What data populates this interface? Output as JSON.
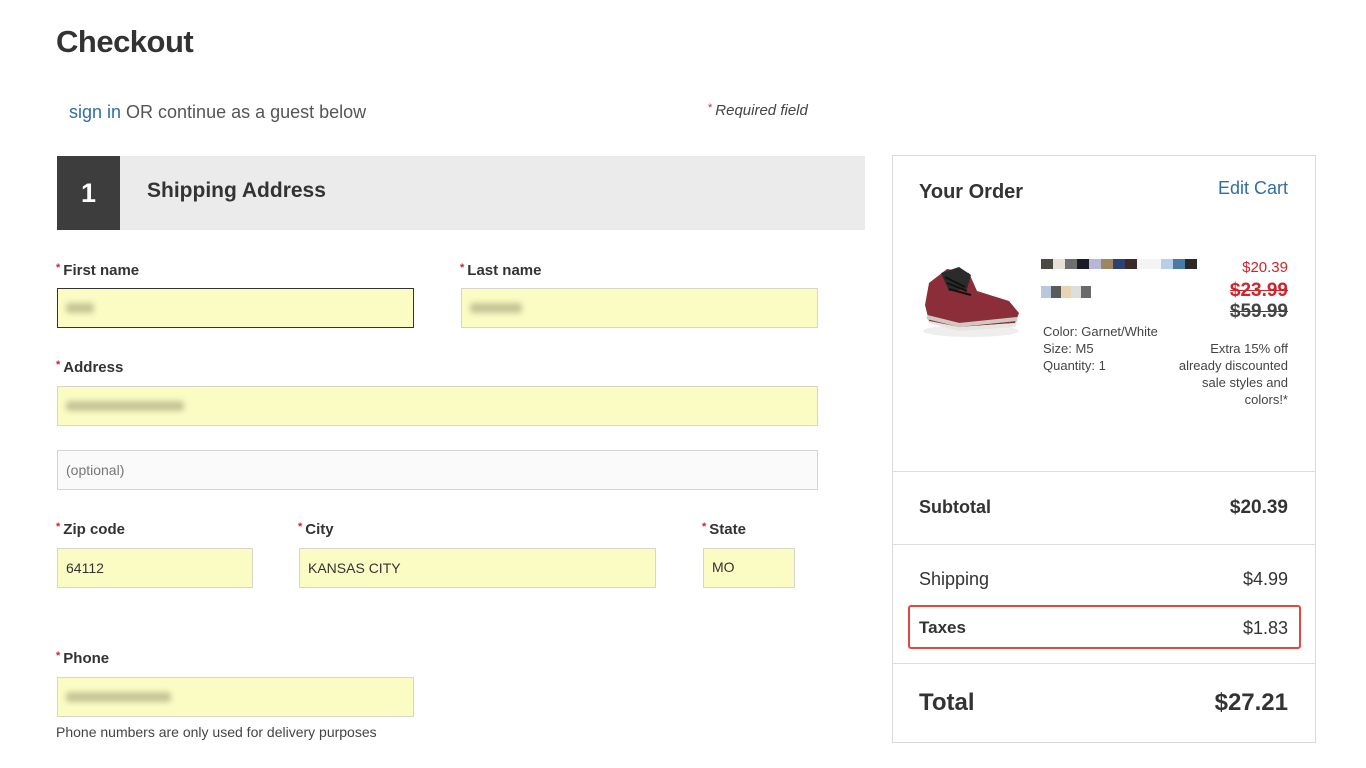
{
  "page": {
    "title": "Checkout",
    "signin_link": "sign in",
    "signin_rest": " OR continue as a guest below",
    "required_marker": "*",
    "required_note": "Required field"
  },
  "step": {
    "number": "1",
    "title": "Shipping Address"
  },
  "form": {
    "first_name": {
      "label": "First name",
      "value_redacted": true
    },
    "last_name": {
      "label": "Last name",
      "value_redacted": true
    },
    "address": {
      "label": "Address",
      "value_redacted": true
    },
    "address2": {
      "placeholder": "(optional)"
    },
    "zip": {
      "label": "Zip code",
      "value": "64112"
    },
    "city": {
      "label": "City",
      "value": "KANSAS CITY"
    },
    "state": {
      "label": "State",
      "value": "MO"
    },
    "phone": {
      "label": "Phone",
      "value_redacted": true
    },
    "phone_hint": "Phone numbers are only used for delivery purposes"
  },
  "order": {
    "title": "Your Order",
    "edit_cart": "Edit Cart",
    "item": {
      "image_icon": "shoe-image",
      "name_redacted": true,
      "color": "Color:  Garnet/White",
      "size": "Size:  M5",
      "quantity": "Quantity: 1",
      "price_now": "$20.39",
      "price_was": "$23.99",
      "price_original": "$59.99",
      "promo": "Extra 15% off already discounted sale styles and colors!*"
    },
    "subtotal": {
      "label": "Subtotal",
      "value": "$20.39"
    },
    "shipping": {
      "label": "Shipping",
      "value": "$4.99"
    },
    "taxes": {
      "label": "Taxes",
      "value": "$1.83"
    },
    "total": {
      "label": "Total",
      "value": "$27.21"
    }
  },
  "colors": {
    "accent_link": "#2f6fa3",
    "required_red": "#d0232a",
    "autofill_yellow": "#fafcc4",
    "highlight_red": "#e5463d"
  }
}
